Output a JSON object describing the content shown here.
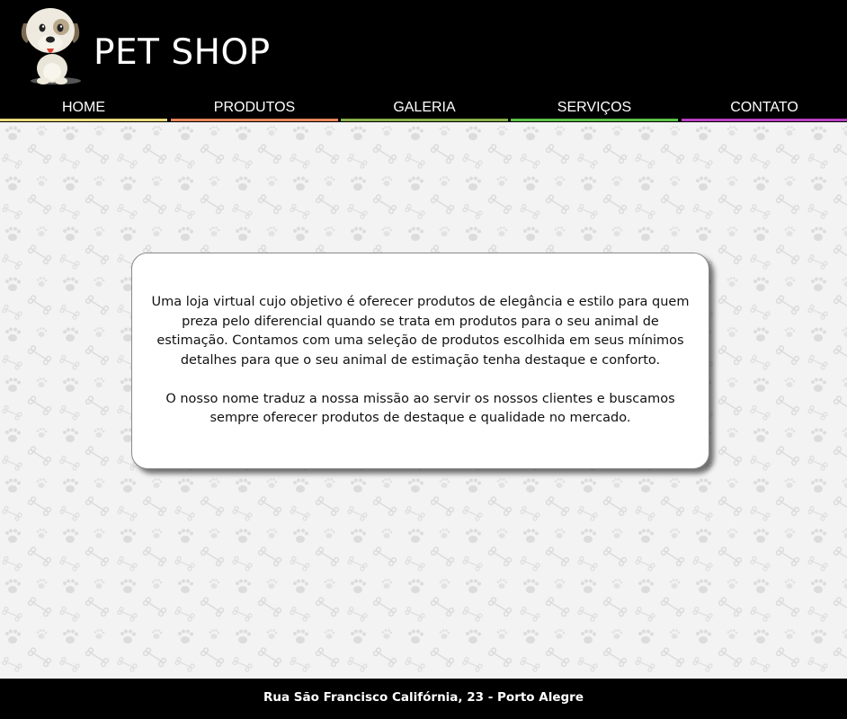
{
  "header": {
    "brand": "PET SHOP",
    "logo_icon": "cartoon-dog-icon"
  },
  "nav": {
    "items": [
      {
        "label": "HOME",
        "color": "#e8d87a"
      },
      {
        "label": "PRODUTOS",
        "color": "#e8845a"
      },
      {
        "label": "GALERIA",
        "color": "#8ab04a"
      },
      {
        "label": "SERVIÇOS",
        "color": "#5ec24a"
      },
      {
        "label": "CONTATO",
        "color": "#b83ec0"
      }
    ]
  },
  "main": {
    "background_pattern": "paw-and-bone-pattern",
    "paragraphs": [
      "Uma loja virtual cujo objetivo é oferecer produtos de elegância e estilo para quem preza pelo diferencial quando se trata em produtos para o seu animal de estimação. Contamos com uma seleção de produtos escolhida em seus mínimos detalhes para que o seu animal de estimação tenha destaque e conforto.",
      "O nosso nome traduz a nossa missão ao servir os nossos clientes e buscamos sempre oferecer produtos de destaque e qualidade no mercado."
    ]
  },
  "footer": {
    "address": "Rua São Francisco Califórnia, 23 - Porto Alegre"
  }
}
